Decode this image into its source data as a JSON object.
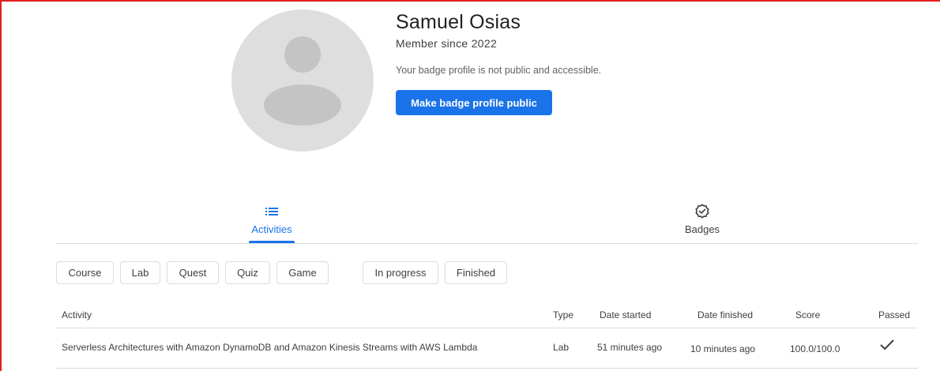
{
  "profile": {
    "name": "Samuel Osias",
    "member_since": "Member since 2022",
    "visibility_notice": "Your badge profile is not public and accessible.",
    "make_public_label": "Make badge profile public"
  },
  "tabs": [
    {
      "label": "Activities",
      "icon": "list-icon",
      "active": true
    },
    {
      "label": "Badges",
      "icon": "badge-check-icon",
      "active": false
    }
  ],
  "filters": {
    "type_chips": [
      "Course",
      "Lab",
      "Quest",
      "Quiz",
      "Game"
    ],
    "status_chips": [
      "In progress",
      "Finished"
    ]
  },
  "table": {
    "headers": [
      "Activity",
      "Type",
      "Date started",
      "Date finished",
      "Score",
      "Passed"
    ],
    "rows": [
      {
        "activity": "Serverless Architectures with Amazon DynamoDB and Amazon Kinesis Streams with AWS Lambda",
        "type": "Lab",
        "date_started": "51 minutes ago",
        "date_finished": "10 minutes ago",
        "score": "100.0/100.0",
        "passed": true
      }
    ]
  },
  "colors": {
    "accent": "#1a73e8",
    "avatar_bg": "#dedede",
    "avatar_fg": "#c4c4c4",
    "divider": "#dadce0"
  }
}
